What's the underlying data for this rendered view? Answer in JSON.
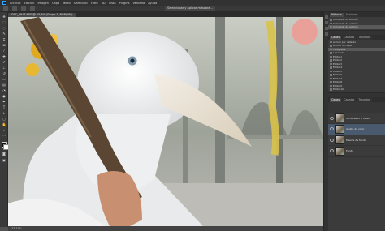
{
  "menu": {
    "items": [
      "Archivo",
      "Edición",
      "Imagen",
      "Capa",
      "Texto",
      "Selección",
      "Filtro",
      "3D",
      "Vista",
      "Plugins",
      "Ventana",
      "Ayuda"
    ]
  },
  "options_bar": {
    "button_label": "Seleccionar y aplicar máscara..."
  },
  "document_tab": {
    "title": "DSC_0917.NEF @ 33,3% (Grupo 1, RGB/16*)"
  },
  "status": {
    "zoom": "33,33%"
  },
  "history_panel": {
    "tabs": [
      "Historia",
      "Acciones"
    ],
    "items": [
      "Comando de edición",
      "Comando de edición",
      "Comando de edición"
    ]
  },
  "right_panel": {
    "tabs": [
      "Capas",
      "Canales",
      "Trazados"
    ],
    "actions": [
      "Acción por defecto",
      "Acción de capa",
      "Fotografía",
      "Laberinto",
      "Estilo 1",
      "Estilo 2",
      "Estilo 3",
      "Estilo 4",
      "Estilo 5",
      "Estilo 6",
      "Estilo 7",
      "Estilo 8",
      "Estilo 9",
      "Estilo 10"
    ]
  },
  "layers_panel": {
    "tabs": [
      "Capas",
      "Canales",
      "Trazados"
    ],
    "layers": [
      {
        "name": "Sombreado y luces"
      },
      {
        "name": "Ajuste de color"
      },
      {
        "name": "Mezcla de fondo"
      },
      {
        "name": "Fondo"
      }
    ]
  },
  "colors": {
    "accent": "#31a8ff",
    "ui_dark": "#323232"
  }
}
